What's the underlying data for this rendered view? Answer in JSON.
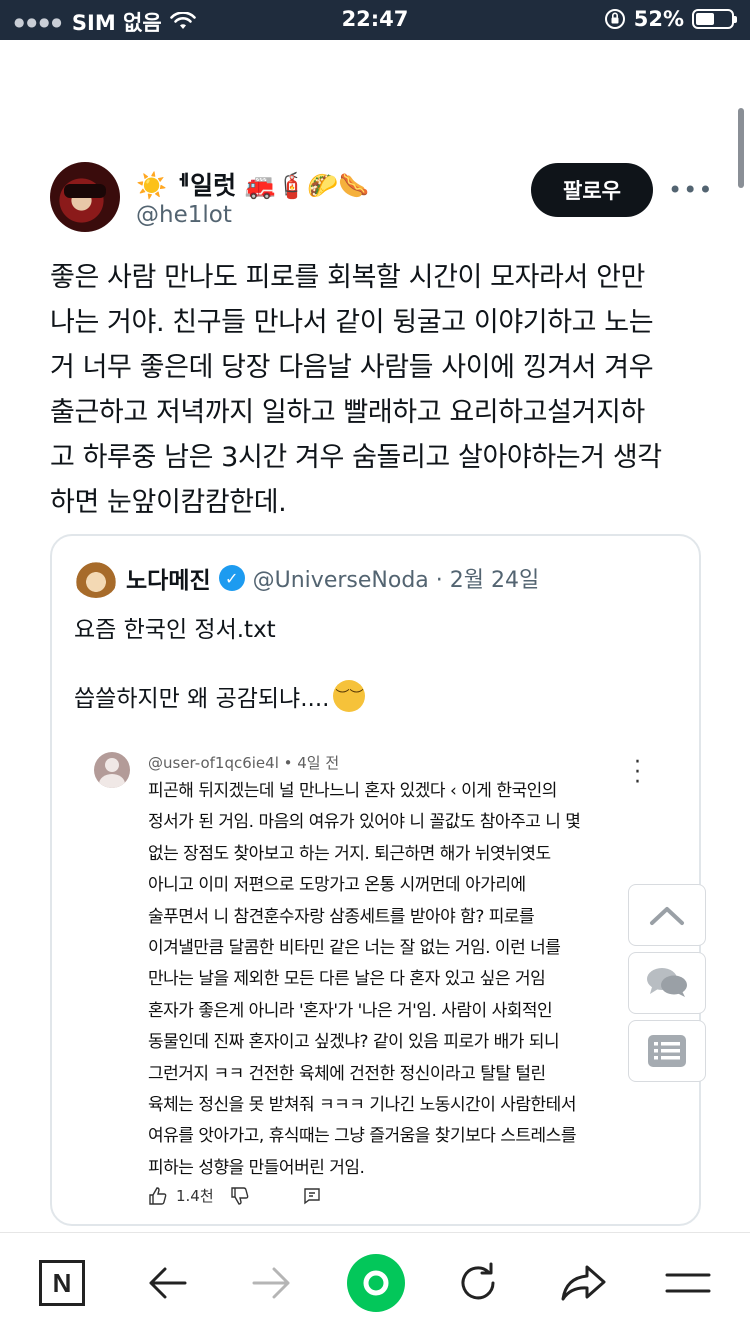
{
  "status_bar": {
    "carrier": "SIM 없음",
    "time": "22:47",
    "battery_percent": "52%",
    "battery_level": 0.52,
    "icons": [
      "signal-dots-icon",
      "wifi-icon",
      "orientation-lock-icon",
      "battery-icon"
    ]
  },
  "tweet": {
    "display_name": "☀️ᅦ일럿 🚒🧯🌮🌭",
    "handle": "@he1lot",
    "follow_label": "팔로우",
    "more_label": "•••",
    "lines": [
      "좋은 사람 만나도 피로를 회복할 시간이 모자라서 안만",
      "나는 거야. 친구들 만나서 같이 뒹굴고 이야기하고 노는",
      "거 너무 좋은데 당장 다음날 사람들 사이에 낑겨서 겨우",
      "출근하고 저녁까지 일하고 빨래하고 요리하고설거지하",
      "고 하루중 남은 3시간 겨우 숨돌리고 살아야하는거 생각",
      "하면 눈앞이캄캄한데."
    ]
  },
  "quote": {
    "name": "노다메진",
    "verified_mark": "✓",
    "handle_date": "@UniverseNoda · 2월 24일",
    "line1": "요즘 한국인 정서.txt",
    "line2": "씁쓸하지만 왜 공감되냐....",
    "comment": {
      "meta": "@user-of1qc6ie4l • 4일 전",
      "lines": [
        "피곤해 뒤지겠는데 널 만나느니 혼자 있겠다 ‹ 이게 한국인의",
        "정서가 된 거임. 마음의 여유가 있어야 니 꼴값도 참아주고 니 몇",
        "없는 장점도 찾아보고 하는 거지. 퇴근하면 해가 뉘엿뉘엿도",
        "아니고 이미 저편으로 도망가고 온통 시꺼먼데 아가리에",
        "술푸면서 니 참견훈수자랑 삼종세트를 받아야 함? 피로를",
        "이겨낼만큼 달콤한 비타민 같은 너는 잘 없는 거임. 이런 너를",
        "만나는 날을 제외한 모든 다른 날은 다 혼자 있고 싶은 거임",
        "혼자가 좋은게 아니라  '혼자'가 '나은 거'임. 사람이 사회적인",
        "동물인데 진짜 혼자이고 싶겠냐? 같이 있음 피로가 배가 되니",
        "그런거지  ㅋㅋ 건전한 육체에 건전한 정신이라고 탈탈 털린",
        "육체는 정신을 못 받쳐줘 ㅋㅋㅋ 기나긴 노동시간이 사람한테서",
        "여유를 앗아가고, 휴식때는 그냥 즐거움을 찾기보다 스트레스를",
        "피하는 성향을 만들어버린 거임."
      ],
      "likes": "1.4천"
    }
  },
  "float_buttons": [
    "scroll-top-icon",
    "comments-icon",
    "list-icon"
  ],
  "toolbar": {
    "home_letter": "N",
    "buttons": [
      "n-home-icon",
      "back-arrow-icon",
      "forward-arrow-icon",
      "green-dot-icon",
      "refresh-icon",
      "share-icon",
      "menu-icon"
    ]
  },
  "colors": {
    "status_bg": "#1f2c3d",
    "verified_blue": "#1d9bf0",
    "naver_green": "#03c75a",
    "text_primary": "#0f1419",
    "text_secondary": "#536471"
  }
}
